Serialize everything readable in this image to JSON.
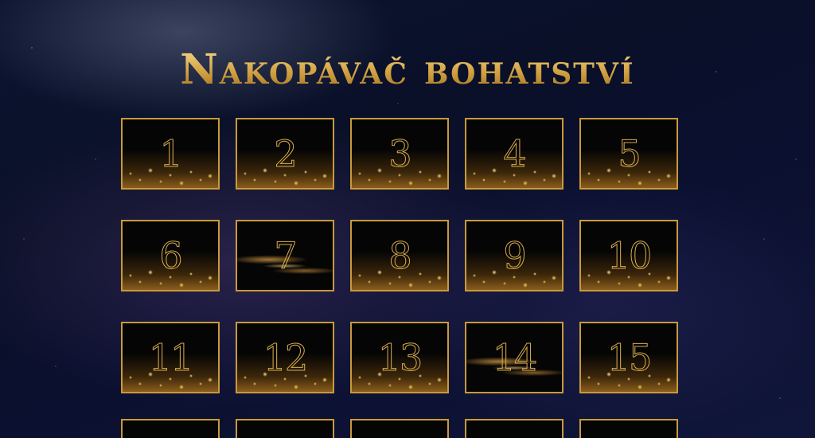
{
  "page": {
    "title": "Nakopávač bohatství",
    "accent_color": "#c99a3a",
    "background_color": "#0a1028"
  },
  "calendar": {
    "tiles": [
      {
        "label": "1",
        "style": "sparkle"
      },
      {
        "label": "2",
        "style": "sparkle"
      },
      {
        "label": "3",
        "style": "sparkle"
      },
      {
        "label": "4",
        "style": "sparkle"
      },
      {
        "label": "5",
        "style": "sparkle"
      },
      {
        "label": "6",
        "style": "sparkle"
      },
      {
        "label": "7",
        "style": "swirl"
      },
      {
        "label": "8",
        "style": "sparkle"
      },
      {
        "label": "9",
        "style": "sparkle"
      },
      {
        "label": "10",
        "style": "sparkle"
      },
      {
        "label": "11",
        "style": "sparkle"
      },
      {
        "label": "12",
        "style": "sparkle"
      },
      {
        "label": "13",
        "style": "sparkle"
      },
      {
        "label": "14",
        "style": "swirl"
      },
      {
        "label": "15",
        "style": "sparkle"
      }
    ],
    "partial_row_count": 5
  }
}
